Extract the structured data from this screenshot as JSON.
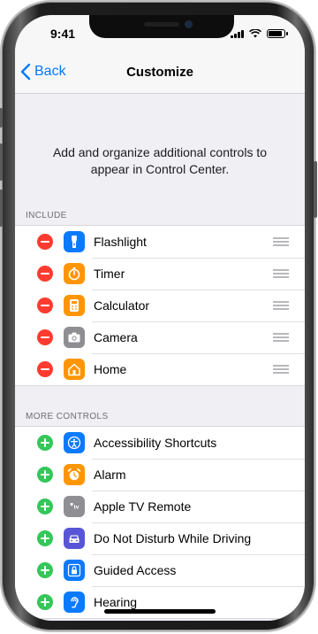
{
  "status_bar": {
    "time": "9:41"
  },
  "navbar": {
    "back_label": "Back",
    "title": "Customize"
  },
  "description": "Add and organize additional controls to appear in Control Center.",
  "sections": {
    "include": {
      "header": "INCLUDE",
      "items": [
        {
          "label": "Flashlight",
          "icon": "flashlight-icon",
          "color": "#0a7aff"
        },
        {
          "label": "Timer",
          "icon": "timer-icon",
          "color": "#ff9500"
        },
        {
          "label": "Calculator",
          "icon": "calculator-icon",
          "color": "#ff9500"
        },
        {
          "label": "Camera",
          "icon": "camera-icon",
          "color": "#8e8e93"
        },
        {
          "label": "Home",
          "icon": "home-icon",
          "color": "#ff9500"
        }
      ]
    },
    "more_controls": {
      "header": "MORE CONTROLS",
      "items": [
        {
          "label": "Accessibility Shortcuts",
          "icon": "accessibility-icon",
          "color": "#0a7aff"
        },
        {
          "label": "Alarm",
          "icon": "alarm-icon",
          "color": "#ff9500"
        },
        {
          "label": "Apple TV Remote",
          "icon": "tv-remote-icon",
          "color": "#8e8e93"
        },
        {
          "label": "Do Not Disturb While Driving",
          "icon": "car-icon",
          "color": "#5856d6"
        },
        {
          "label": "Guided Access",
          "icon": "lock-icon",
          "color": "#0a7aff"
        },
        {
          "label": "Hearing",
          "icon": "ear-icon",
          "color": "#0a7aff"
        }
      ]
    }
  },
  "colors": {
    "remove": "#ff3b30",
    "add": "#34c759",
    "accent": "#007aff"
  }
}
